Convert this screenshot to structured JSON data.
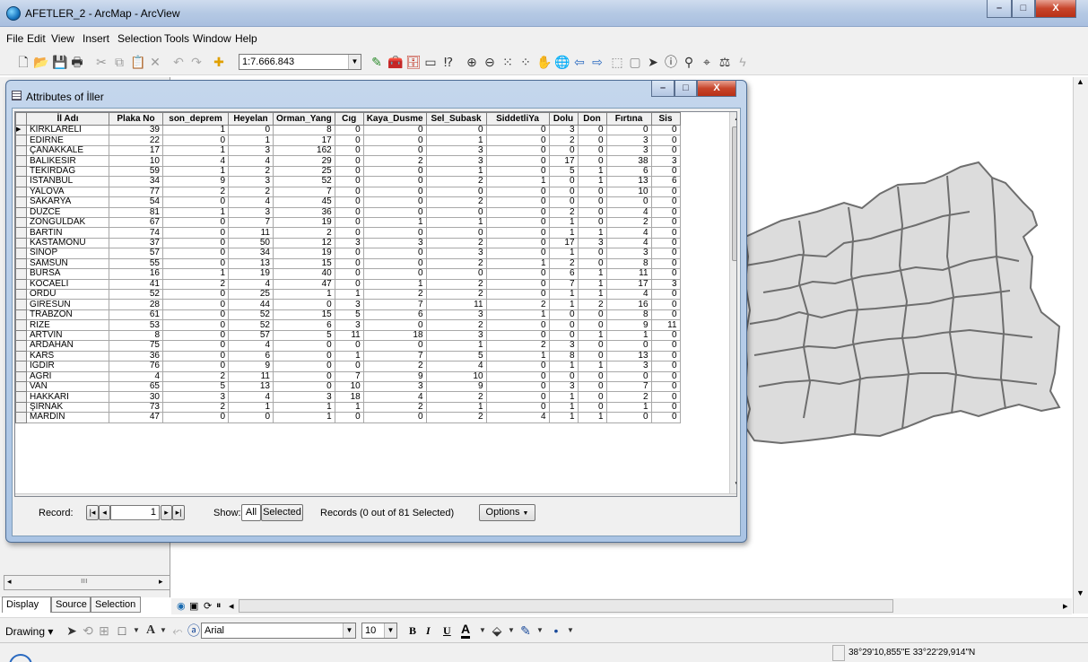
{
  "window": {
    "title": "AFETLER_2 - ArcMap - ArcView",
    "min": "–",
    "max": "□",
    "close": "X"
  },
  "menu": [
    "File",
    "Edit",
    "View",
    "Insert",
    "Selection",
    "Tools",
    "Window",
    "Help"
  ],
  "toolbar": {
    "scale": "1:7.666.843"
  },
  "attr": {
    "title": "Attributes of İller",
    "columns": [
      "İl Adı",
      "Plaka No",
      "son_deprem",
      "Heyelan",
      "Orman_Yang",
      "Cıg",
      "Kaya_Dusme",
      "Sel_Subask",
      "SiddetliYa",
      "Dolu",
      "Don",
      "Fırtına",
      "Sis"
    ],
    "rows": [
      [
        "KIRKLARELİ",
        "39",
        "1",
        "0",
        "8",
        "0",
        "0",
        "0",
        "0",
        "3",
        "0",
        "0",
        "0"
      ],
      [
        "EDİRNE",
        "22",
        "0",
        "1",
        "17",
        "0",
        "0",
        "1",
        "0",
        "2",
        "0",
        "3",
        "0"
      ],
      [
        "ÇANAKKALE",
        "17",
        "1",
        "3",
        "162",
        "0",
        "0",
        "3",
        "0",
        "0",
        "0",
        "3",
        "0"
      ],
      [
        "BALIKESİR",
        "10",
        "4",
        "4",
        "29",
        "0",
        "2",
        "3",
        "0",
        "17",
        "0",
        "38",
        "3"
      ],
      [
        "TEKİRDAĞ",
        "59",
        "1",
        "2",
        "25",
        "0",
        "0",
        "1",
        "0",
        "5",
        "1",
        "6",
        "0"
      ],
      [
        "İSTANBUL",
        "34",
        "9",
        "3",
        "52",
        "0",
        "0",
        "2",
        "1",
        "0",
        "1",
        "13",
        "6"
      ],
      [
        "YALOVA",
        "77",
        "2",
        "2",
        "7",
        "0",
        "0",
        "0",
        "0",
        "0",
        "0",
        "10",
        "0"
      ],
      [
        "SAKARYA",
        "54",
        "0",
        "4",
        "45",
        "0",
        "0",
        "2",
        "0",
        "0",
        "0",
        "0",
        "0"
      ],
      [
        "DÜZCE",
        "81",
        "1",
        "3",
        "36",
        "0",
        "0",
        "0",
        "0",
        "2",
        "0",
        "4",
        "0"
      ],
      [
        "ZONGULDAK",
        "67",
        "0",
        "7",
        "19",
        "0",
        "1",
        "1",
        "0",
        "1",
        "0",
        "2",
        "0"
      ],
      [
        "BARTIN",
        "74",
        "0",
        "11",
        "2",
        "0",
        "0",
        "0",
        "0",
        "1",
        "1",
        "4",
        "0"
      ],
      [
        "KASTAMONU",
        "37",
        "0",
        "50",
        "12",
        "3",
        "3",
        "2",
        "0",
        "17",
        "3",
        "4",
        "0"
      ],
      [
        "SİNOP",
        "57",
        "0",
        "34",
        "19",
        "0",
        "0",
        "3",
        "0",
        "1",
        "0",
        "3",
        "0"
      ],
      [
        "SAMSUN",
        "55",
        "0",
        "13",
        "15",
        "0",
        "0",
        "2",
        "1",
        "2",
        "0",
        "8",
        "0"
      ],
      [
        "BURSA",
        "16",
        "1",
        "19",
        "40",
        "0",
        "0",
        "0",
        "0",
        "6",
        "1",
        "11",
        "0"
      ],
      [
        "KOCAELİ",
        "41",
        "2",
        "4",
        "47",
        "0",
        "1",
        "2",
        "0",
        "7",
        "1",
        "17",
        "3"
      ],
      [
        "ORDU",
        "52",
        "0",
        "25",
        "1",
        "1",
        "2",
        "2",
        "0",
        "1",
        "1",
        "4",
        "0"
      ],
      [
        "GİRESUN",
        "28",
        "0",
        "44",
        "0",
        "3",
        "7",
        "11",
        "2",
        "1",
        "2",
        "16",
        "0"
      ],
      [
        "TRABZON",
        "61",
        "0",
        "52",
        "15",
        "5",
        "6",
        "3",
        "1",
        "0",
        "0",
        "8",
        "0"
      ],
      [
        "RİZE",
        "53",
        "0",
        "52",
        "6",
        "3",
        "0",
        "2",
        "0",
        "0",
        "0",
        "9",
        "11"
      ],
      [
        "ARTVİN",
        "8",
        "0",
        "57",
        "5",
        "11",
        "18",
        "3",
        "0",
        "0",
        "1",
        "1",
        "0"
      ],
      [
        "ARDAHAN",
        "75",
        "0",
        "4",
        "0",
        "0",
        "0",
        "1",
        "2",
        "3",
        "0",
        "0",
        "0"
      ],
      [
        "KARS",
        "36",
        "0",
        "6",
        "0",
        "1",
        "7",
        "5",
        "1",
        "8",
        "0",
        "13",
        "0"
      ],
      [
        "IĞDIR",
        "76",
        "0",
        "9",
        "0",
        "0",
        "2",
        "4",
        "0",
        "1",
        "1",
        "3",
        "0"
      ],
      [
        "AĞRI",
        "4",
        "2",
        "11",
        "0",
        "7",
        "9",
        "10",
        "0",
        "0",
        "0",
        "0",
        "0"
      ],
      [
        "VAN",
        "65",
        "5",
        "13",
        "0",
        "10",
        "3",
        "9",
        "0",
        "3",
        "0",
        "7",
        "0"
      ],
      [
        "HAKKARİ",
        "30",
        "3",
        "4",
        "3",
        "18",
        "4",
        "2",
        "0",
        "1",
        "0",
        "2",
        "0"
      ],
      [
        "ŞIRNAK",
        "73",
        "2",
        "1",
        "1",
        "1",
        "2",
        "1",
        "0",
        "1",
        "0",
        "1",
        "0"
      ],
      [
        "MARDİN",
        "47",
        "0",
        "0",
        "1",
        "0",
        "0",
        "2",
        "4",
        "1",
        "1",
        "0",
        "0"
      ]
    ],
    "footer": {
      "record_label": "Record:",
      "record_value": "1",
      "show_label": "Show:",
      "all": "All",
      "selected": "Selected",
      "records_status": "Records (0 out of 81 Selected)",
      "options": "Options"
    }
  },
  "tabs": [
    "Display",
    "Source",
    "Selection"
  ],
  "drawing": {
    "label": "Drawing",
    "font": "Arial",
    "size": "10",
    "bold": "B",
    "italic": "I",
    "underline": "U",
    "text_color": "A"
  },
  "status": {
    "coordinates": "38°29'10,855\"E  33°22'29,914\"N"
  },
  "colors": {
    "title_bar": "#b9cde6",
    "map_fill": "#dcdcdc",
    "map_stroke": "#6e6e6e"
  }
}
